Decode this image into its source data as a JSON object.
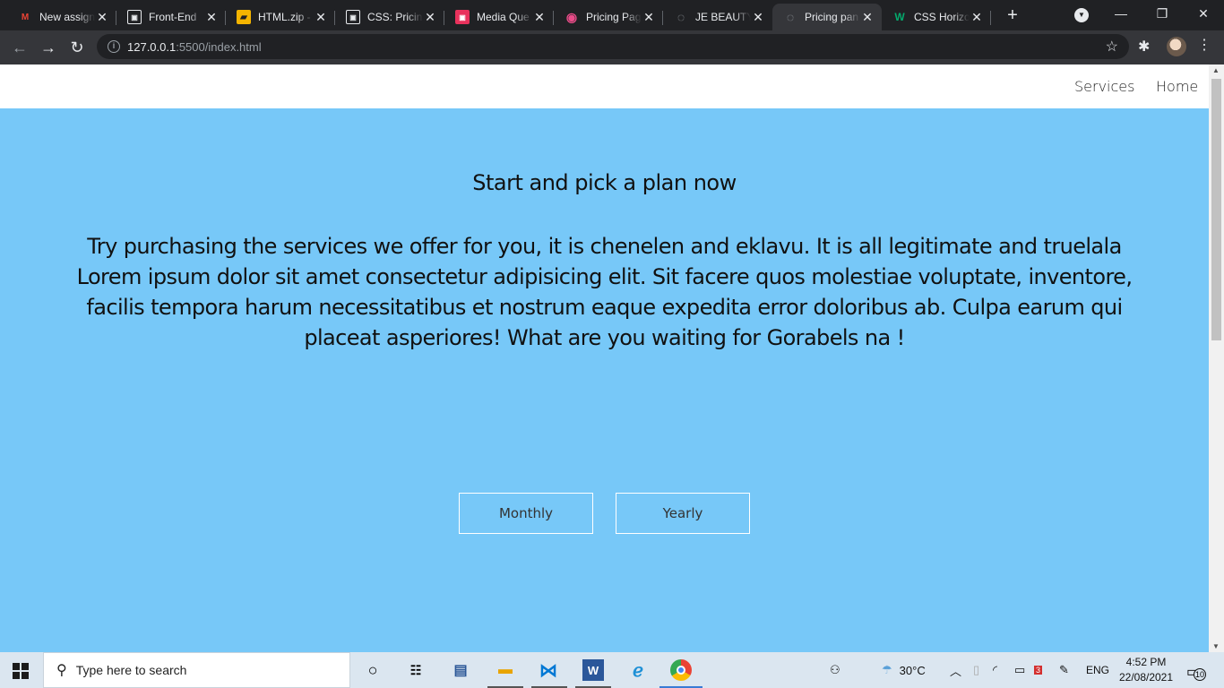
{
  "browser": {
    "tabs": [
      {
        "title": "New assign",
        "favicon": "M",
        "favicon_color": "#ea4335"
      },
      {
        "title": "Front-End",
        "favicon": "▣",
        "favicon_color": "#e8eaed"
      },
      {
        "title": "HTML.zip -",
        "favicon": "▰",
        "favicon_color": "#f4b400"
      },
      {
        "title": "CSS: Pricing",
        "favicon": "▣",
        "favicon_color": "#e8eaed"
      },
      {
        "title": "Media Que",
        "favicon": "▣",
        "favicon_color": "#e8325c"
      },
      {
        "title": "Pricing Pag",
        "favicon": "◉",
        "favicon_color": "#ea4c89"
      },
      {
        "title": "JE BEAUTY",
        "favicon": "◌",
        "favicon_color": "#9aa0a6"
      },
      {
        "title": "Pricing pan",
        "favicon": "◌",
        "favicon_color": "#9aa0a6"
      },
      {
        "title": "CSS Horizo",
        "favicon": "W",
        "favicon_color": "#04aa6d"
      }
    ],
    "new_tab_label": "+",
    "url_host": "127.0.0.1",
    "url_rest": ":5500/index.html"
  },
  "page": {
    "nav": {
      "services": "Services",
      "home": "Home"
    },
    "title": "Start and pick a plan now",
    "description": "Try purchasing the services we offer for you, it is chenelen and eklavu. It is all legitimate and truelala Lorem ipsum dolor sit amet consectetur adipisicing elit. Sit facere quos molestiae voluptate, inventore, facilis tempora harum necessitatibus et nostrum eaque expedita error doloribus ab. Culpa earum qui placeat asperiores! What are you waiting for Gorabels na !",
    "buttons": {
      "monthly": "Monthly",
      "yearly": "Yearly"
    },
    "background_color": "#77c8f8"
  },
  "taskbar": {
    "search_placeholder": "Type here to search",
    "temperature": "30°C",
    "language": "ENG",
    "time": "4:52 PM",
    "date": "22/08/2021",
    "notification_count": "10",
    "battery_badge": "3"
  }
}
